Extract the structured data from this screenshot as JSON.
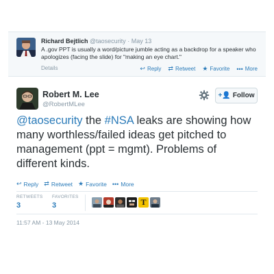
{
  "quoted_tweet": {
    "name": "Richard Bejtlich",
    "handle": "@taosecurity",
    "date": "May 13",
    "text": "A .gov PPT is usually a word/picture jumble acting as a backdrop for a speaker who apologizes (facing the slide) for \"making an eye chart.\"",
    "details_label": "Details",
    "actions": {
      "reply": "Reply",
      "retweet": "Retweet",
      "favorite": "Favorite",
      "more": "More"
    }
  },
  "tweet": {
    "name": "Robert M. Lee",
    "handle": "@RobertMLee",
    "follow_label": "Follow",
    "text_parts": {
      "mention": "@taosecurity",
      "text1": " the ",
      "hashtag": "#NSA",
      "text2": " leaks are showing how many worthless/failed ideas get pitched to management (ppt = mgmt). Problems of different kinds."
    },
    "actions": {
      "reply": "Reply",
      "retweet": "Retweet",
      "favorite": "Favorite",
      "more": "More"
    },
    "stats": {
      "retweets_label": "RETWEETS",
      "retweets": "3",
      "favorites_label": "FAVORITES",
      "favorites": "3"
    },
    "favoriter_avatar_letter": "T",
    "timestamp": "11:57 AM - 13 May 2014"
  },
  "colors": {
    "link": "#2b7bb9",
    "muted": "#8899a6",
    "text": "#292f33"
  },
  "icons": [
    "reply-icon",
    "retweet-icon",
    "favorite-star-icon",
    "more-dots-icon",
    "gear-icon",
    "follow-person-icon"
  ]
}
